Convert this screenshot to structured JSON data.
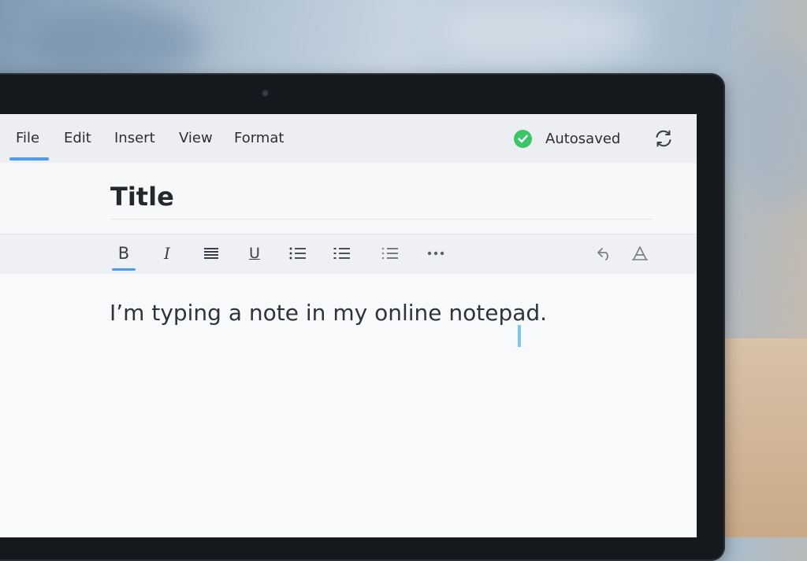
{
  "menubar": {
    "items": [
      {
        "label": "File",
        "active": true
      },
      {
        "label": "Edit"
      },
      {
        "label": "Insert"
      },
      {
        "label": "View"
      },
      {
        "label": "Format"
      }
    ],
    "status_text": "Autosaved",
    "status_icon": "check-circle-icon",
    "status_color": "#3cc46b",
    "sync_icon": "sync-icon"
  },
  "document": {
    "title": "Title",
    "body": "I’m typing a note in my online notepad."
  },
  "toolbar": {
    "tools": [
      {
        "name": "bold",
        "glyph": "B",
        "active": true
      },
      {
        "name": "italic",
        "glyph": "I"
      },
      {
        "name": "align",
        "icon": "align-justify-icon"
      },
      {
        "name": "underline",
        "glyph": "U"
      },
      {
        "name": "bulleted-list",
        "icon": "bulleted-list-icon"
      },
      {
        "name": "numbered-list",
        "icon": "list-icon"
      },
      {
        "name": "checklist",
        "icon": "checklist-icon"
      },
      {
        "name": "more",
        "icon": "more-icon"
      },
      {
        "name": "undo",
        "icon": "undo-icon"
      },
      {
        "name": "text-style",
        "icon": "text-format-icon"
      }
    ]
  },
  "colors": {
    "accent": "#4f9bea",
    "caret": "#7cc6f0"
  }
}
